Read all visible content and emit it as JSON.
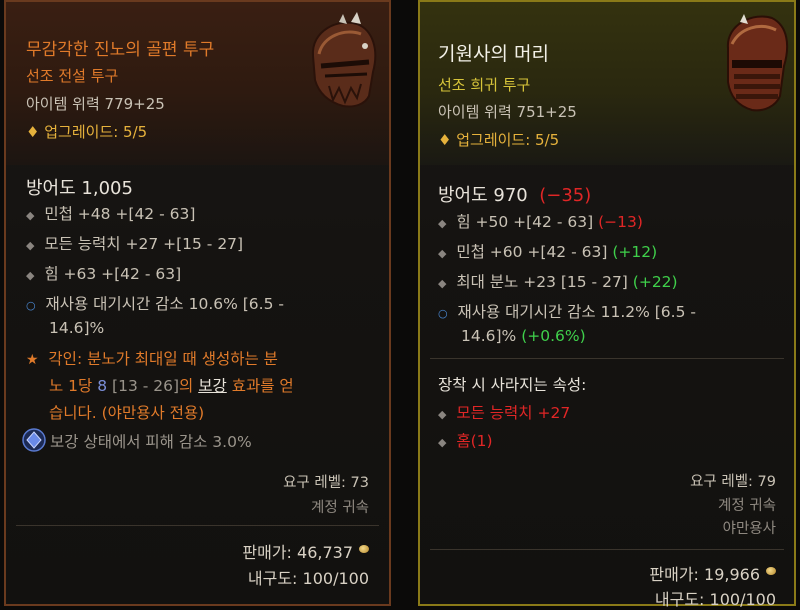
{
  "left": {
    "name": "무감각한 진노의 골편 투구",
    "type": "선조 전설 투구",
    "item_power": "아이템 위력 779+25",
    "upgrade_label": "업그레이드: 5/5",
    "armor_label": "방어도 1,005",
    "stats": [
      "민첩 +48 +[42 - 63]",
      "모든 능력치 +27 +[15 - 27]",
      "힘 +63 +[42 - 63]"
    ],
    "cooldown_line1": "재사용 대기시간 감소 10.6% [6.5 -",
    "cooldown_line2": "14.6]%",
    "aspect_prefix": "각인: ",
    "aspect_line1": "분노가 최대일 때 생성하는 분",
    "aspect_line2_a": "노 1당 ",
    "aspect_line2_value": "8",
    "aspect_line2_range": " [13 - 26]",
    "aspect_line2_b": "의 ",
    "aspect_line2_keyword": "보강",
    "aspect_line2_c": " 효과를 얻",
    "aspect_line3": "습니다. (야만용사 전용)",
    "gem_text": "보강 상태에서 피해 감소 3.0%",
    "req_level": "요구 레벨: 73",
    "account_bound": "계정 귀속",
    "sell_label": "판매가: 46,737",
    "durability": "내구도: 100/100"
  },
  "right": {
    "name": "기원사의 머리",
    "type": "선조 희귀 투구",
    "item_power": "아이템 위력 751+25",
    "upgrade_label": "업그레이드: 5/5",
    "armor_label": "방어도 970",
    "armor_diff": "(−35)",
    "stats": [
      {
        "text": "힘 +50 +[42 - 63] ",
        "diff": "(−13)",
        "diff_color": "red"
      },
      {
        "text": "민첩 +60 +[42 - 63] ",
        "diff": "(+12)",
        "diff_color": "green"
      },
      {
        "text": "최대 분노 +23 [15 - 27] ",
        "diff": "(+22)",
        "diff_color": "green"
      }
    ],
    "cooldown_line1": "재사용 대기시간 감소 11.2% [6.5 -",
    "cooldown_line2_a": "14.6]% ",
    "cooldown_line2_diff": "(+0.6%)",
    "lost_header": "장착 시 사라지는 속성:",
    "lost_items": [
      "모든 능력치 +27",
      "홈(1)"
    ],
    "req_level": "요구 레벨: 79",
    "account_bound": "계정 귀속",
    "class_req": "야만용사",
    "sell_label": "판매가: 19,966",
    "durability": "내구도: 100/100"
  }
}
